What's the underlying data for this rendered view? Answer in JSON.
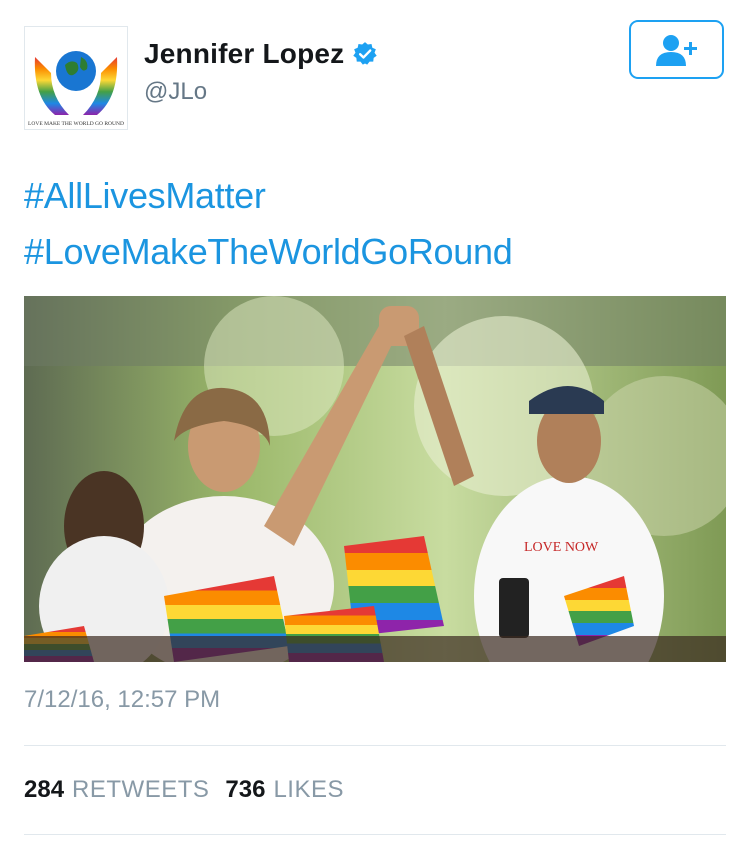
{
  "user": {
    "name": "Jennifer Lopez",
    "handle": "@JLo",
    "avatar_caption": "LOVE MAKE THE WORLD GO ROUND",
    "verified_icon": "verified-badge-icon"
  },
  "follow_button": {
    "icon": "add-user-icon"
  },
  "tweet": {
    "hashtags": [
      "#AllLivesMatter",
      "#LoveMakeTheWorldGoRound"
    ],
    "photo_alt": "Photo",
    "timestamp": "7/12/16, 12:57 PM"
  },
  "stats": {
    "retweets_count": "284",
    "retweets_label": "RETWEETS",
    "likes_count": "736",
    "likes_label": "LIKES"
  },
  "colors": {
    "link": "#1b95e0",
    "accent": "#1da1f2",
    "text": "#14171a",
    "muted": "#8899a6",
    "border": "#e1e8ed"
  }
}
